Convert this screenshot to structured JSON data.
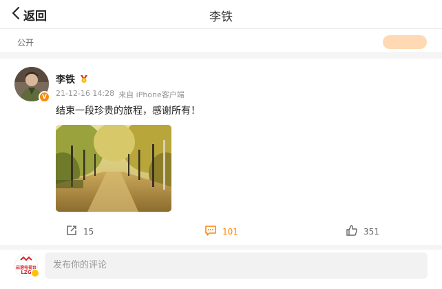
{
  "header": {
    "back_label": "返回",
    "title": "李铁"
  },
  "visibility": {
    "label": "公开"
  },
  "post": {
    "author": "李铁",
    "time": "21-12-16 14:28",
    "source": "来自 iPhone客户端",
    "text": "结束一段珍贵的旅程，感谢所有！",
    "verified_badge_letter": "V"
  },
  "actions": {
    "repost_count": "15",
    "comment_count": "101",
    "like_count": "351"
  },
  "composer": {
    "placeholder": "发布你的评论",
    "avatar_line1": "岩溶电视台",
    "avatar_line2": "LZG"
  },
  "colors": {
    "accent": "#ff8200",
    "verified": "#f78a09"
  }
}
